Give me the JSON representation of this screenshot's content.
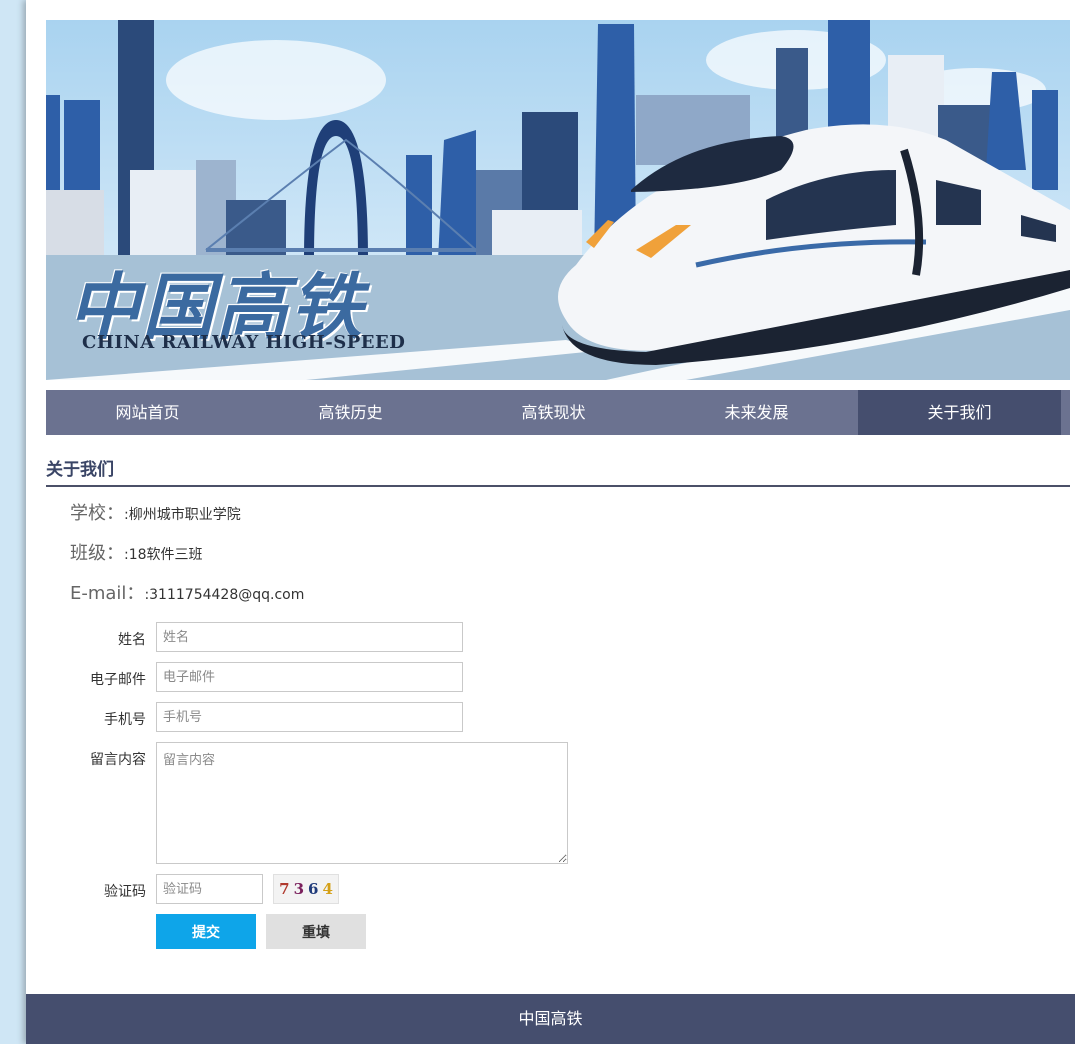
{
  "banner": {
    "title": "中国高铁",
    "subtitle": "CHINA RAILWAY HIGH-SPEED"
  },
  "nav": {
    "items": [
      {
        "label": "网站首页"
      },
      {
        "label": "高铁历史"
      },
      {
        "label": "高铁现状"
      },
      {
        "label": "未来发展"
      },
      {
        "label": "关于我们"
      }
    ],
    "active_index": 4
  },
  "section": {
    "title": "关于我们"
  },
  "info": {
    "school_key": "学校：",
    "school_value": ":柳州城市职业学院",
    "class_key": "班级：",
    "class_value": ":18软件三班",
    "email_key": "E-mail：",
    "email_value": ":3111754428@qq.com"
  },
  "form": {
    "name_label": "姓名",
    "name_placeholder": "姓名",
    "email_label": "电子邮件",
    "email_placeholder": "电子邮件",
    "phone_label": "手机号",
    "phone_placeholder": "手机号",
    "message_label": "留言内容",
    "message_placeholder": "留言内容",
    "captcha_label": "验证码",
    "captcha_placeholder": "验证码",
    "captcha_chars": [
      "7",
      "3",
      "6",
      "4"
    ],
    "captcha_colors": [
      "#b03a2e",
      "#7a1f5c",
      "#1f3a7a",
      "#d4a017"
    ],
    "submit_label": "提交",
    "reset_label": "重填"
  },
  "footer": {
    "text": "中国高铁"
  },
  "colors": {
    "nav_bg": "#6b7290",
    "nav_active": "#454e6e",
    "footer_bg": "#454e6e",
    "submit_bg": "#0ea5e9",
    "page_bg": "#cfe6f5"
  }
}
